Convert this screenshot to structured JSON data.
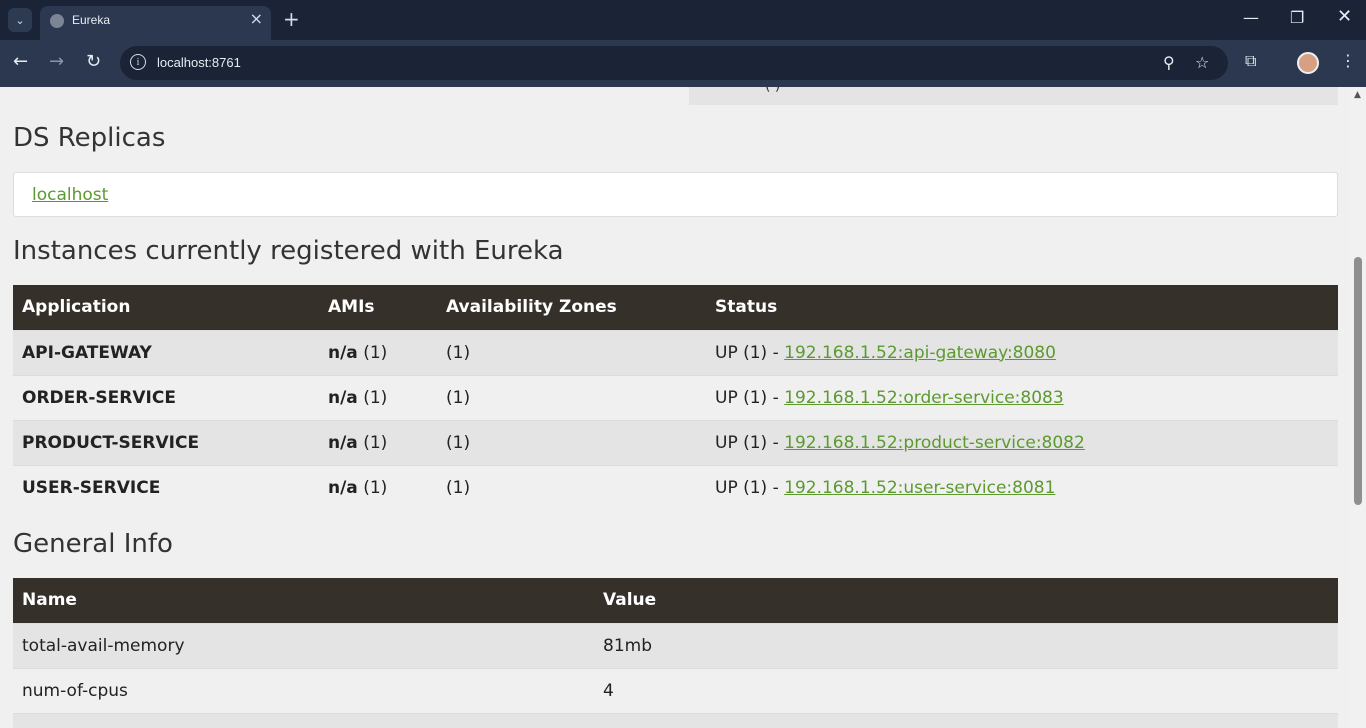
{
  "browser": {
    "tab_title": "Eureka",
    "url": "localhost:8761"
  },
  "top_box": {
    "text": "(    )"
  },
  "replicas": {
    "heading": "DS Replicas",
    "link": "localhost"
  },
  "instances": {
    "heading": "Instances currently registered with Eureka",
    "columns": [
      "Application",
      "AMIs",
      "Availability Zones",
      "Status"
    ],
    "rows": [
      {
        "app": "API-GATEWAY",
        "ami_label": "n/a",
        "ami_count": "(1)",
        "zones": "(1)",
        "status": "UP (1) -",
        "link": "192.168.1.52:api-gateway:8080"
      },
      {
        "app": "ORDER-SERVICE",
        "ami_label": "n/a",
        "ami_count": "(1)",
        "zones": "(1)",
        "status": "UP (1) -",
        "link": "192.168.1.52:order-service:8083"
      },
      {
        "app": "PRODUCT-SERVICE",
        "ami_label": "n/a",
        "ami_count": "(1)",
        "zones": "(1)",
        "status": "UP (1) -",
        "link": "192.168.1.52:product-service:8082"
      },
      {
        "app": "USER-SERVICE",
        "ami_label": "n/a",
        "ami_count": "(1)",
        "zones": "(1)",
        "status": "UP (1) -",
        "link": "192.168.1.52:user-service:8081"
      }
    ]
  },
  "general": {
    "heading": "General Info",
    "columns": [
      "Name",
      "Value"
    ],
    "rows": [
      {
        "name": "total-avail-memory",
        "value": "81mb"
      },
      {
        "name": "num-of-cpus",
        "value": "4"
      },
      {
        "name": "",
        "value": ""
      }
    ]
  }
}
